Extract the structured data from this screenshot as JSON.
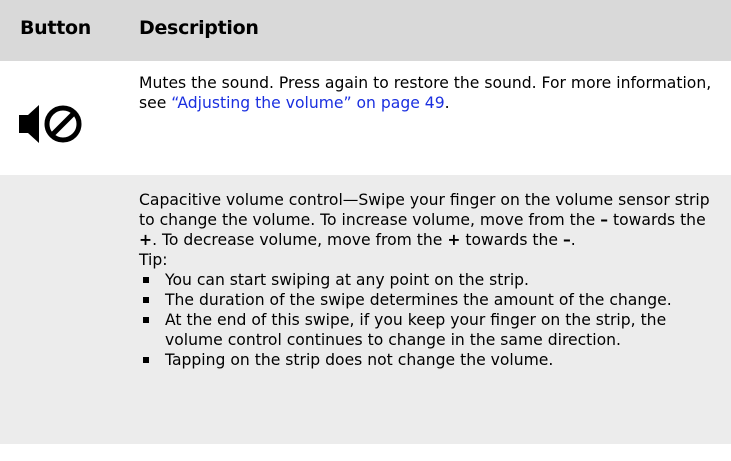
{
  "header": {
    "col_button": "Button",
    "col_description": "Description"
  },
  "rows": [
    {
      "icon": "mute-speaker-icon",
      "text_before": "Mutes the sound. Press again to restore the sound. For more information, see ",
      "link_text": "“Adjusting the volume” on page 49",
      "text_after": "."
    },
    {
      "icon": "",
      "main_pre": "Capacitive volume control—Swipe your finger on the volume sensor strip to change the volume. To increase volume, move from the ",
      "minus1": "–",
      "mid1": " towards the ",
      "plus1": "+",
      "mid2": ". To decrease volume, move from the ",
      "plus2": "+",
      "mid3": " towards the ",
      "minus2": "–",
      "end": ".",
      "tip_label": "Tip:",
      "tips": [
        "You can start swiping at any point on the strip.",
        "The duration of the swipe determines the amount of the change.",
        "At the end of this swipe, if you keep your finger on the strip, the volume control continues to change in the same direction.",
        "Tapping on the strip does not change the volume."
      ]
    }
  ],
  "colors": {
    "header_bg": "#d9d9d9",
    "row2_bg": "#ececec",
    "link": "#1a2fe0"
  }
}
